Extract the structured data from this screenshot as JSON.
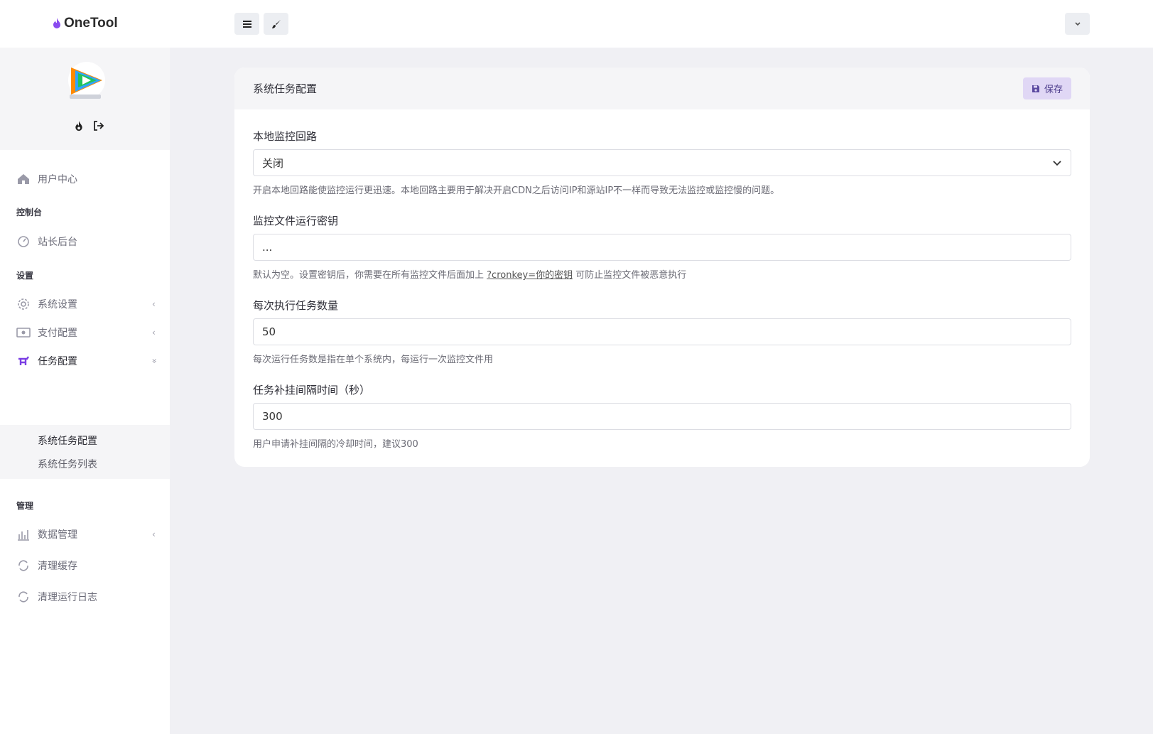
{
  "header": {
    "brand": "OneTool",
    "menu_icon": "hamburger-icon",
    "theme_icon": "paint-brush-icon",
    "user_icon": "chevron-down-icon"
  },
  "sidebar": {
    "logo_icon": "tencent-video-logo",
    "items": [
      {
        "label": "用户中心",
        "icon": "home-icon"
      },
      {
        "section": "控制台"
      },
      {
        "label": "站长后台",
        "icon": "dashboard-icon"
      },
      {
        "section": "设置"
      },
      {
        "label": "系统设置",
        "icon": "gear-icon",
        "arrow": "‹"
      },
      {
        "label": "支付配置",
        "icon": "money-icon",
        "arrow": "‹"
      },
      {
        "label": "任务配置",
        "icon": "task-icon",
        "arrow": "»"
      },
      {
        "section": "管理"
      },
      {
        "label": "数据管理",
        "icon": "bar-chart-icon",
        "arrow": "‹"
      },
      {
        "label": "清理缓存",
        "icon": "refresh-icon"
      },
      {
        "label": "清理运行日志",
        "icon": "refresh-icon"
      }
    ],
    "sub_items": [
      "系统任务配置",
      "系统任务列表"
    ]
  },
  "card": {
    "title": "系统任务配置",
    "save_label": "保存",
    "fields": [
      {
        "label": "本地监控回路",
        "value": "关闭",
        "help": "开启本地回路能使监控运行更迅速。本地回路主要用于解决开启CDN之后访问IP和源站IP不一样而导致无法监控或监控慢的问题。"
      },
      {
        "label": "监控文件运行密钥",
        "value": "...",
        "help_prefix": "默认为空。设置密钥后，你需要在所有监控文件后面加上 ",
        "help_code": "?cronkey=你的密钥",
        "help_suffix": " 可防止监控文件被恶意执行"
      },
      {
        "label": "每次执行任务数量",
        "value": "50",
        "help": "每次运行任务数是指在单个系统内，每运行一次监控文件用"
      },
      {
        "label": "任务补挂间隔时间（秒）",
        "value": "300",
        "help": "用户申请补挂间隔的冷却时间，建议300"
      }
    ]
  },
  "colors": {
    "accent": "#7b3fe4",
    "save_bg": "#e0d7f5",
    "page_bg": "#f0f0f4"
  }
}
